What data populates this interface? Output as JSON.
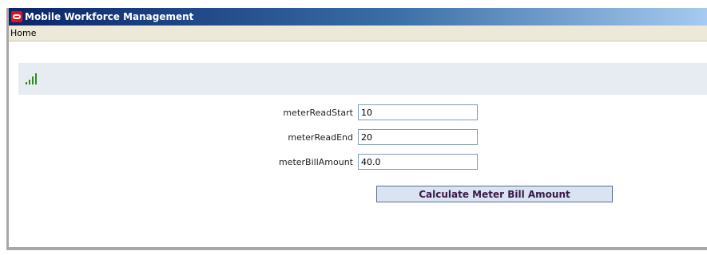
{
  "window": {
    "title": "Mobile Workforce Management",
    "app_icon": "oracle-logo-icon"
  },
  "menu": {
    "home_label": "Home"
  },
  "header": {
    "icon": "signal-strength-icon",
    "icon_color": "#2e8b1e"
  },
  "form": {
    "fields": [
      {
        "label": "meterReadStart",
        "value": "10"
      },
      {
        "label": "meterReadEnd",
        "value": "20"
      },
      {
        "label": "meterBillAmount",
        "value": "40.0"
      }
    ],
    "calculate_label": "Calculate Meter Bill Amount"
  },
  "colors": {
    "titlebar_start": "#0a246a",
    "titlebar_end": "#a6caf0",
    "button_bg": "#d9e3f1",
    "button_text": "#3a1a48"
  }
}
